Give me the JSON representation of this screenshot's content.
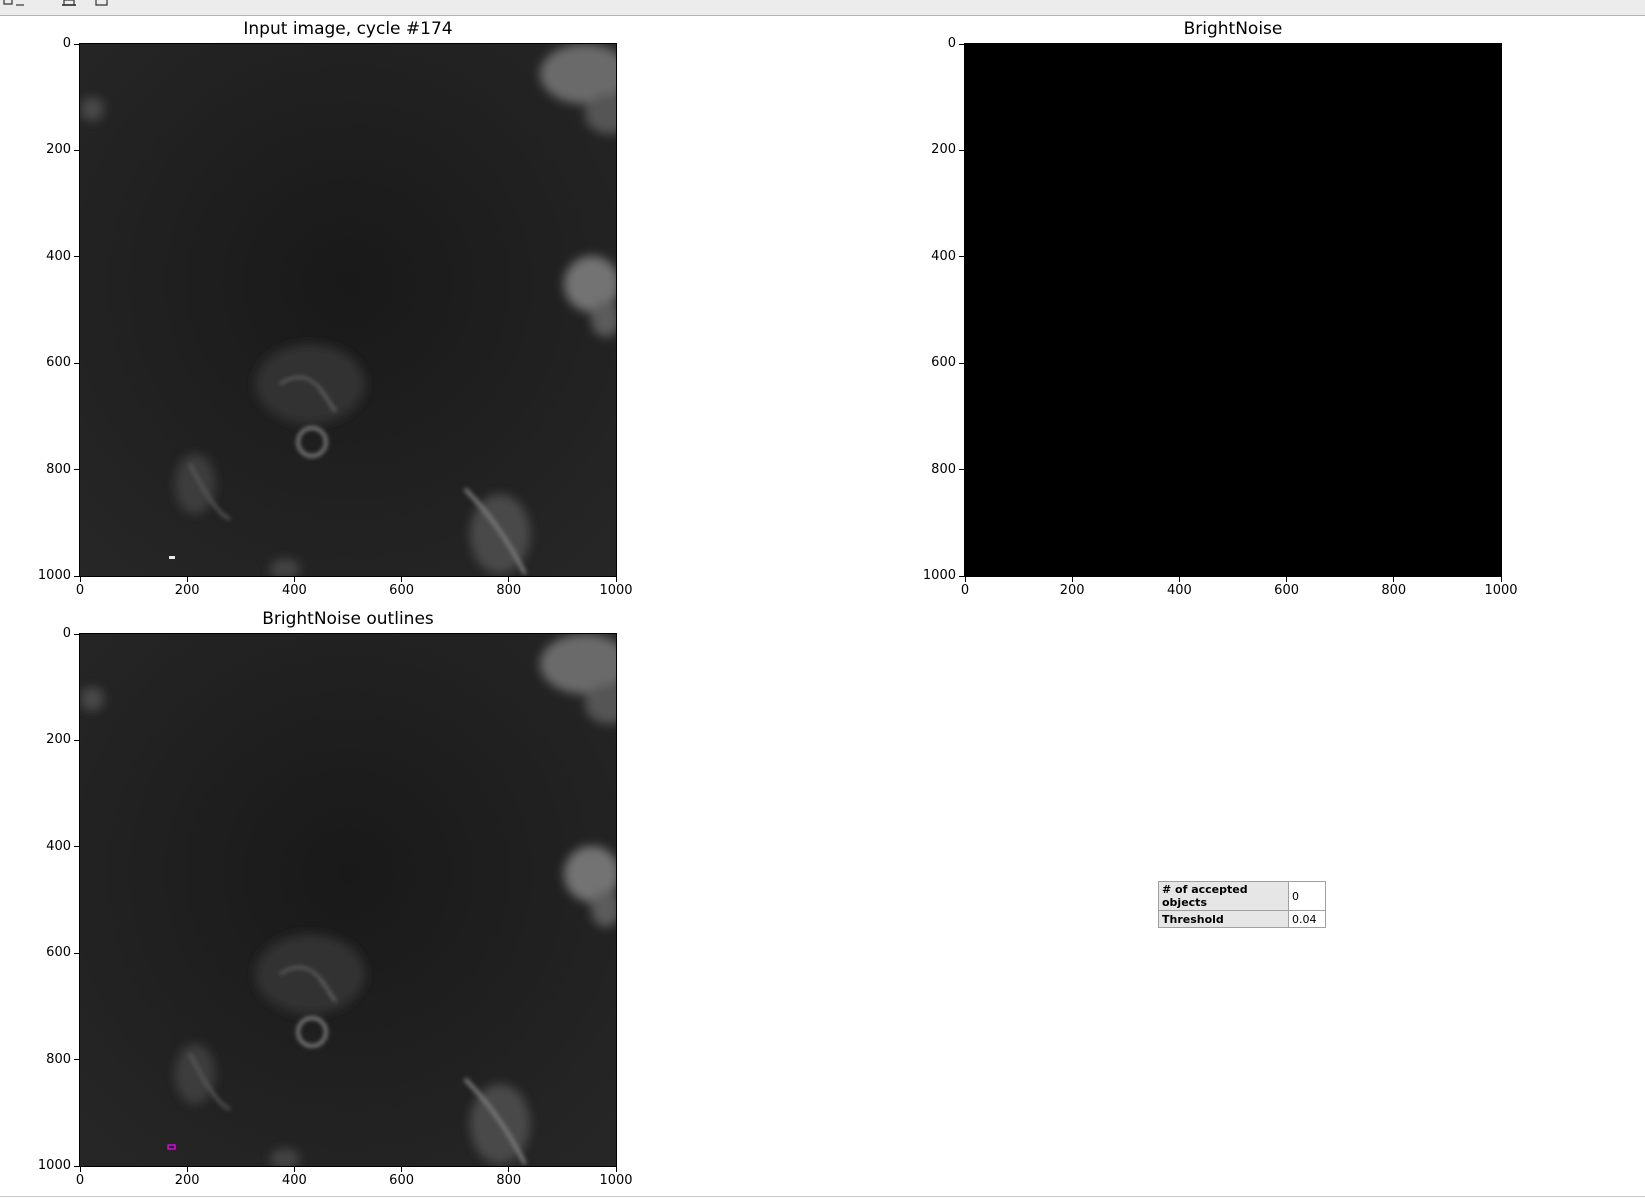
{
  "figure": {
    "panels": [
      {
        "id": "input",
        "title": "Input image, cycle #174",
        "image": "grayscale micrograph"
      },
      {
        "id": "brightnoise",
        "title": "BrightNoise",
        "image": "black"
      },
      {
        "id": "outlines",
        "title": "BrightNoise outlines",
        "image": "grayscale micrograph with outline"
      }
    ],
    "axes": {
      "x_ticks": [
        "0",
        "200",
        "400",
        "600",
        "800",
        "1000"
      ],
      "y_ticks": [
        "0",
        "200",
        "400",
        "600",
        "800",
        "1000"
      ],
      "range": [
        0,
        1000
      ]
    }
  },
  "stats_table": {
    "rows": [
      {
        "label": "# of accepted objects",
        "value": "0"
      },
      {
        "label": "Threshold",
        "value": "0.04"
      }
    ]
  },
  "colors": {
    "image_background": "#1a1a1a",
    "outline": "#ff00ff",
    "toolbar": "#ececec"
  }
}
